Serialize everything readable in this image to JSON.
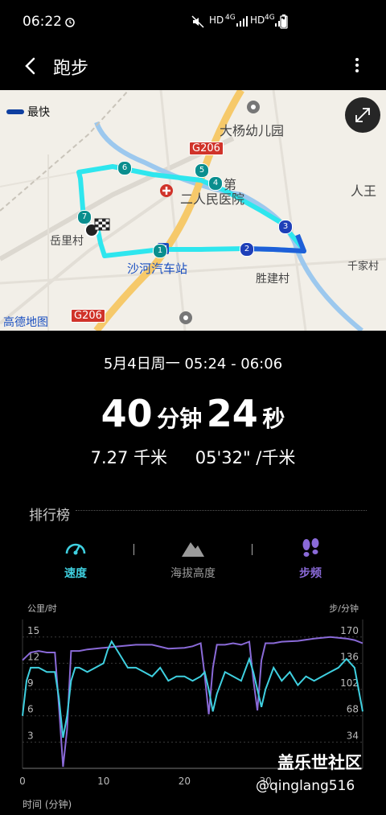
{
  "status_bar": {
    "time": "06:22",
    "hd1": "HD",
    "net1": "4G",
    "hd2": "HD",
    "net2": "4G"
  },
  "header": {
    "title": "跑步",
    "back_glyph": "‹",
    "more_glyph": "⋮"
  },
  "map": {
    "legend_label": "最快",
    "labels": {
      "dayang": "大杨幼儿园",
      "renwang": "人王",
      "hospital_1": "第",
      "hospital_2": "二人民医院",
      "yueli": "岳里村",
      "shahe": "沙河汽车站",
      "shengjian": "胜建村",
      "qianjia": "千家村",
      "provider": "高德地图",
      "road_top": "G206",
      "road_bottom": "G206"
    },
    "checkpoints": [
      "1",
      "2",
      "3",
      "4",
      "5",
      "6",
      "7"
    ],
    "colors": {
      "route_fast": "#00e0ec",
      "route_mid": "#1e5fd8",
      "river": "#9cc8ee",
      "road": "#f6c96a"
    }
  },
  "summary": {
    "datetime": "5月4日周一 05:24 - 06:06",
    "minutes": "40",
    "minutes_unit": "分钟",
    "seconds": "24",
    "seconds_unit": "秒",
    "distance": "7.27 千米",
    "pace": "05'32\" /千米"
  },
  "leaderboard": {
    "label": "排行榜"
  },
  "tabs": [
    {
      "label": "速度",
      "icon": "speedometer-icon",
      "color": "#3fd0e0",
      "active": true
    },
    {
      "label": "海拔高度",
      "icon": "mountain-icon",
      "color": "#9a9a9a",
      "active": false
    },
    {
      "label": "步频",
      "icon": "footprints-icon",
      "color": "#8a6ad8",
      "active": true
    }
  ],
  "chart_data": {
    "type": "line",
    "left_axis_label": "公里/时",
    "right_axis_label": "步/分钟",
    "xlabel": "时间 (分钟)",
    "x_ticks": [
      "0",
      "10",
      "20",
      "30"
    ],
    "xlim": [
      0,
      42
    ],
    "left_ticks": [
      "3",
      "6",
      "9",
      "12",
      "15"
    ],
    "right_ticks": [
      "34",
      "68",
      "102",
      "136",
      "170"
    ],
    "ylim_left": [
      0,
      17
    ],
    "ylim_right": [
      0,
      192.7
    ],
    "series": [
      {
        "name": "速度",
        "axis": "left",
        "color": "#3fd0e0",
        "x": [
          0,
          0.5,
          1,
          2,
          3,
          4,
          4.5,
          5,
          5.5,
          6,
          6.5,
          7,
          8,
          9,
          10,
          10.5,
          11,
          12,
          13,
          14,
          15,
          16,
          17,
          18,
          19,
          20,
          21,
          22,
          22.5,
          23,
          23.5,
          24,
          25,
          26,
          27,
          28,
          28.5,
          29,
          29.5,
          30,
          31,
          32,
          33,
          34,
          35,
          36,
          37,
          38,
          39,
          40,
          41,
          42
        ],
        "y": [
          6,
          10,
          11.5,
          11.5,
          11,
          11,
          8,
          3.5,
          6,
          10,
          11.5,
          11.5,
          11,
          11.5,
          12,
          13.5,
          14.5,
          13,
          11.5,
          11.5,
          11,
          10.5,
          11.5,
          10,
          10.5,
          10.5,
          10,
          10.5,
          11,
          9,
          6.5,
          8.5,
          11,
          10.5,
          10,
          12.5,
          11,
          9,
          7,
          9,
          11.5,
          10,
          11,
          9.5,
          10.5,
          10,
          10.5,
          11,
          11.5,
          12.5,
          11.5,
          6.5
        ]
      },
      {
        "name": "步频",
        "axis": "right",
        "color": "#8a6ad8",
        "x": [
          0,
          0.5,
          1,
          2,
          3,
          4,
          4.5,
          5,
          5.5,
          6,
          7,
          8,
          10,
          12,
          14,
          16,
          18,
          20,
          21,
          22,
          22.5,
          23,
          23.5,
          24,
          25,
          26,
          27,
          28,
          28.5,
          29,
          29.5,
          30,
          31,
          32,
          34,
          36,
          38,
          40,
          41,
          42
        ],
        "y": [
          140,
          145,
          150,
          152,
          150,
          150,
          80,
          2,
          50,
          152,
          152,
          154,
          156,
          158,
          160,
          160,
          155,
          156,
          158,
          162,
          120,
          70,
          130,
          160,
          160,
          162,
          160,
          164,
          115,
          75,
          140,
          162,
          162,
          164,
          165,
          168,
          170,
          168,
          166,
          162
        ]
      }
    ]
  },
  "watermark": {
    "line1": "盖乐世社区",
    "line2": "@qinglang516"
  }
}
